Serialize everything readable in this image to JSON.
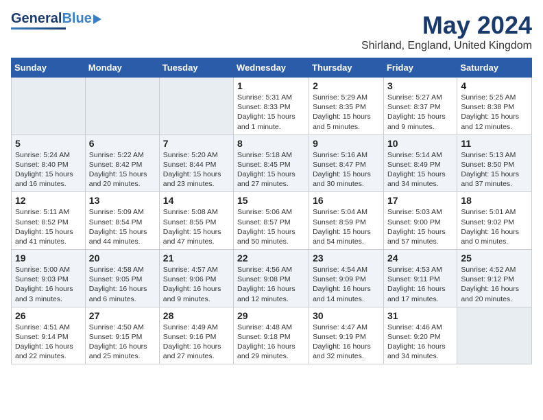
{
  "header": {
    "logo": {
      "general": "General",
      "blue": "Blue"
    },
    "title": "May 2024",
    "location": "Shirland, England, United Kingdom"
  },
  "weekdays": [
    "Sunday",
    "Monday",
    "Tuesday",
    "Wednesday",
    "Thursday",
    "Friday",
    "Saturday"
  ],
  "weeks": [
    [
      {
        "day": "",
        "info": ""
      },
      {
        "day": "",
        "info": ""
      },
      {
        "day": "",
        "info": ""
      },
      {
        "day": "1",
        "info": "Sunrise: 5:31 AM\nSunset: 8:33 PM\nDaylight: 15 hours\nand 1 minute."
      },
      {
        "day": "2",
        "info": "Sunrise: 5:29 AM\nSunset: 8:35 PM\nDaylight: 15 hours\nand 5 minutes."
      },
      {
        "day": "3",
        "info": "Sunrise: 5:27 AM\nSunset: 8:37 PM\nDaylight: 15 hours\nand 9 minutes."
      },
      {
        "day": "4",
        "info": "Sunrise: 5:25 AM\nSunset: 8:38 PM\nDaylight: 15 hours\nand 12 minutes."
      }
    ],
    [
      {
        "day": "5",
        "info": "Sunrise: 5:24 AM\nSunset: 8:40 PM\nDaylight: 15 hours\nand 16 minutes."
      },
      {
        "day": "6",
        "info": "Sunrise: 5:22 AM\nSunset: 8:42 PM\nDaylight: 15 hours\nand 20 minutes."
      },
      {
        "day": "7",
        "info": "Sunrise: 5:20 AM\nSunset: 8:44 PM\nDaylight: 15 hours\nand 23 minutes."
      },
      {
        "day": "8",
        "info": "Sunrise: 5:18 AM\nSunset: 8:45 PM\nDaylight: 15 hours\nand 27 minutes."
      },
      {
        "day": "9",
        "info": "Sunrise: 5:16 AM\nSunset: 8:47 PM\nDaylight: 15 hours\nand 30 minutes."
      },
      {
        "day": "10",
        "info": "Sunrise: 5:14 AM\nSunset: 8:49 PM\nDaylight: 15 hours\nand 34 minutes."
      },
      {
        "day": "11",
        "info": "Sunrise: 5:13 AM\nSunset: 8:50 PM\nDaylight: 15 hours\nand 37 minutes."
      }
    ],
    [
      {
        "day": "12",
        "info": "Sunrise: 5:11 AM\nSunset: 8:52 PM\nDaylight: 15 hours\nand 41 minutes."
      },
      {
        "day": "13",
        "info": "Sunrise: 5:09 AM\nSunset: 8:54 PM\nDaylight: 15 hours\nand 44 minutes."
      },
      {
        "day": "14",
        "info": "Sunrise: 5:08 AM\nSunset: 8:55 PM\nDaylight: 15 hours\nand 47 minutes."
      },
      {
        "day": "15",
        "info": "Sunrise: 5:06 AM\nSunset: 8:57 PM\nDaylight: 15 hours\nand 50 minutes."
      },
      {
        "day": "16",
        "info": "Sunrise: 5:04 AM\nSunset: 8:59 PM\nDaylight: 15 hours\nand 54 minutes."
      },
      {
        "day": "17",
        "info": "Sunrise: 5:03 AM\nSunset: 9:00 PM\nDaylight: 15 hours\nand 57 minutes."
      },
      {
        "day": "18",
        "info": "Sunrise: 5:01 AM\nSunset: 9:02 PM\nDaylight: 16 hours\nand 0 minutes."
      }
    ],
    [
      {
        "day": "19",
        "info": "Sunrise: 5:00 AM\nSunset: 9:03 PM\nDaylight: 16 hours\nand 3 minutes."
      },
      {
        "day": "20",
        "info": "Sunrise: 4:58 AM\nSunset: 9:05 PM\nDaylight: 16 hours\nand 6 minutes."
      },
      {
        "day": "21",
        "info": "Sunrise: 4:57 AM\nSunset: 9:06 PM\nDaylight: 16 hours\nand 9 minutes."
      },
      {
        "day": "22",
        "info": "Sunrise: 4:56 AM\nSunset: 9:08 PM\nDaylight: 16 hours\nand 12 minutes."
      },
      {
        "day": "23",
        "info": "Sunrise: 4:54 AM\nSunset: 9:09 PM\nDaylight: 16 hours\nand 14 minutes."
      },
      {
        "day": "24",
        "info": "Sunrise: 4:53 AM\nSunset: 9:11 PM\nDaylight: 16 hours\nand 17 minutes."
      },
      {
        "day": "25",
        "info": "Sunrise: 4:52 AM\nSunset: 9:12 PM\nDaylight: 16 hours\nand 20 minutes."
      }
    ],
    [
      {
        "day": "26",
        "info": "Sunrise: 4:51 AM\nSunset: 9:14 PM\nDaylight: 16 hours\nand 22 minutes."
      },
      {
        "day": "27",
        "info": "Sunrise: 4:50 AM\nSunset: 9:15 PM\nDaylight: 16 hours\nand 25 minutes."
      },
      {
        "day": "28",
        "info": "Sunrise: 4:49 AM\nSunset: 9:16 PM\nDaylight: 16 hours\nand 27 minutes."
      },
      {
        "day": "29",
        "info": "Sunrise: 4:48 AM\nSunset: 9:18 PM\nDaylight: 16 hours\nand 29 minutes."
      },
      {
        "day": "30",
        "info": "Sunrise: 4:47 AM\nSunset: 9:19 PM\nDaylight: 16 hours\nand 32 minutes."
      },
      {
        "day": "31",
        "info": "Sunrise: 4:46 AM\nSunset: 9:20 PM\nDaylight: 16 hours\nand 34 minutes."
      },
      {
        "day": "",
        "info": ""
      }
    ]
  ]
}
